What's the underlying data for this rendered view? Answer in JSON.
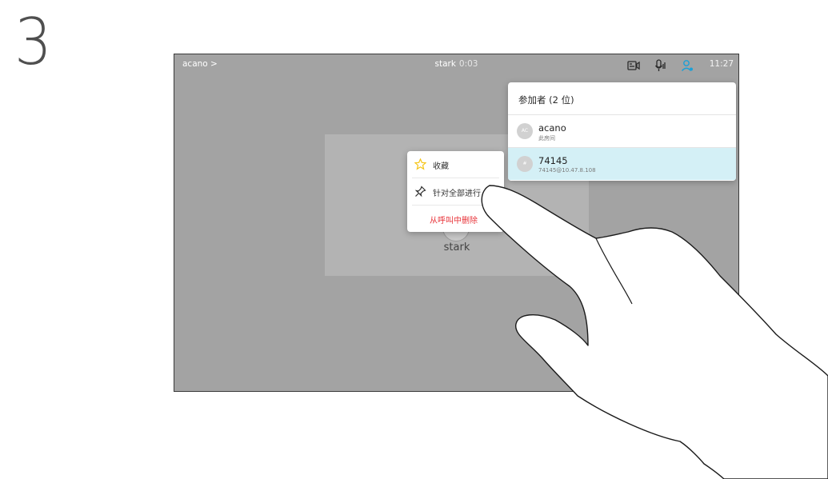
{
  "step": {
    "number": "3"
  },
  "topbar": {
    "breadcrumb": "acano >",
    "call_name": "stark",
    "call_timer": "0:03",
    "clock": "11:27",
    "icons": [
      "layout-icon",
      "mic-icon",
      "participants-icon"
    ]
  },
  "video_tile": {
    "name": "stark"
  },
  "participants_panel": {
    "title": "参加者 (2 位)",
    "items": [
      {
        "initials": "AC",
        "name": "acano",
        "sub": "此房间",
        "selected": false
      },
      {
        "initials": "#",
        "name": "74145",
        "sub": "74145@10.47.8.108",
        "selected": true
      }
    ]
  },
  "context_menu": {
    "items": [
      {
        "icon": "star-icon",
        "label": "收藏"
      },
      {
        "icon": "pin-icon",
        "label": "针对全部进行"
      },
      {
        "icon": "",
        "label": "从呼叫中删除"
      }
    ]
  },
  "colors": {
    "screen_bg": "#a3a3a3",
    "accent": "#1ba0d7",
    "selected_row": "#d4f0f6",
    "danger": "#e8343a",
    "star": "#f5c518"
  }
}
